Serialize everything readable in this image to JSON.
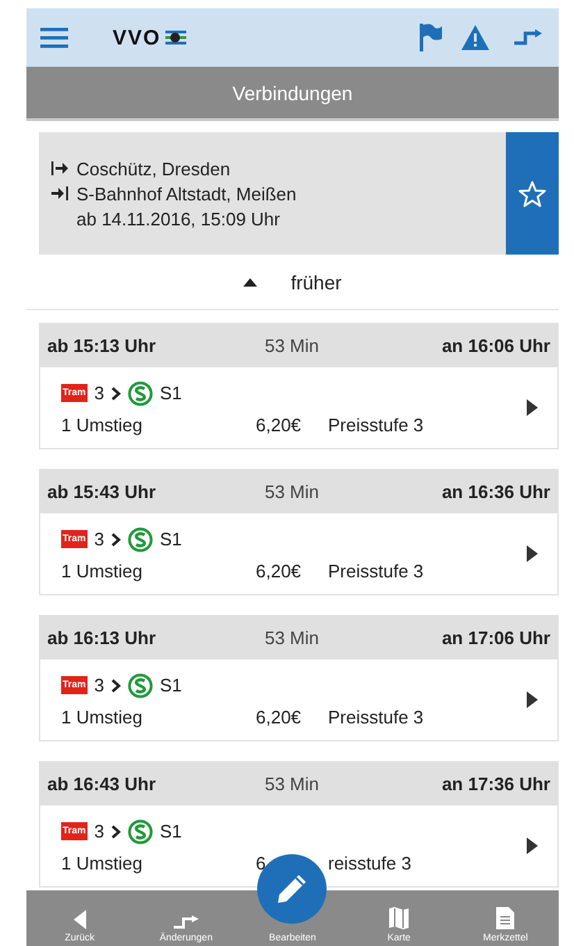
{
  "header": {
    "logo": "VVO"
  },
  "title": "Verbindungen",
  "query": {
    "from": "Coschütz, Dresden",
    "to": "S-Bahnhof Altstadt, Meißen",
    "time": "ab 14.11.2016, 15:09 Uhr"
  },
  "earlier": "früher",
  "connections": [
    {
      "depart": "ab 15:13 Uhr",
      "duration": "53 Min",
      "arrive": "an 16:06 Uhr",
      "tram_badge": "Tram",
      "tram_line": "3",
      "sbahn_line": "S1",
      "changes": "1 Umstieg",
      "price": "6,20€",
      "fare": "Preisstufe 3"
    },
    {
      "depart": "ab 15:43 Uhr",
      "duration": "53 Min",
      "arrive": "an 16:36 Uhr",
      "tram_badge": "Tram",
      "tram_line": "3",
      "sbahn_line": "S1",
      "changes": "1 Umstieg",
      "price": "6,20€",
      "fare": "Preisstufe 3"
    },
    {
      "depart": "ab 16:13 Uhr",
      "duration": "53 Min",
      "arrive": "an 17:06 Uhr",
      "tram_badge": "Tram",
      "tram_line": "3",
      "sbahn_line": "S1",
      "changes": "1 Umstieg",
      "price": "6,20€",
      "fare": "Preisstufe 3"
    },
    {
      "depart": "ab 16:43 Uhr",
      "duration": "53 Min",
      "arrive": "an 17:36 Uhr",
      "tram_badge": "Tram",
      "tram_line": "3",
      "sbahn_line": "S1",
      "changes": "1 Umstieg",
      "price": "6",
      "fare": "reisstufe 3"
    }
  ],
  "nav": [
    {
      "kind": "back",
      "label": "Zurück"
    },
    {
      "kind": "changes",
      "label": "Änderungen"
    },
    {
      "kind": "edit",
      "label": "Bearbeiten"
    },
    {
      "kind": "map",
      "label": "Karte"
    },
    {
      "kind": "notes",
      "label": "Merkzettel"
    }
  ]
}
